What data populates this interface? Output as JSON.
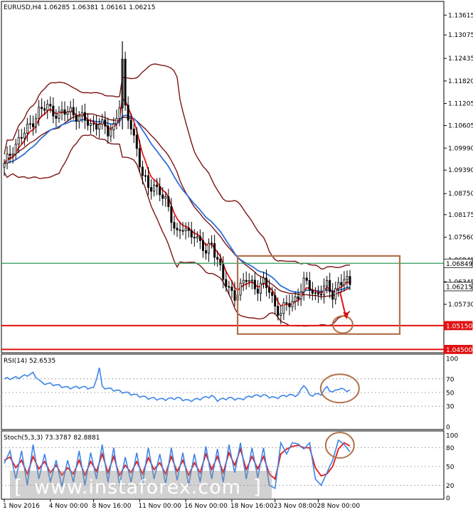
{
  "chart_data": {
    "type": "candlestick",
    "symbol_header": "EURUSD,H4 1.06285 1.06381 1.06161 1.06215",
    "main": {
      "ylim": [
        1.0445,
        1.1395
      ],
      "y_ticks": [
        "1.13615",
        "1.13075",
        "1.12435",
        "1.11820",
        "1.11205",
        "1.10605",
        "1.09990",
        "1.09390",
        "1.08750",
        "1.08175",
        "1.07560",
        "1.06945",
        "1.06345",
        "1.05730",
        "1.05150",
        "1.04500"
      ],
      "price_tags": [
        {
          "label": "1.06849",
          "value": 1.06849,
          "bg": "#ffffff",
          "fg": "#000000",
          "line": "#2e9a58"
        },
        {
          "label": "1.06215",
          "value": 1.06215,
          "bg": "#ffffff",
          "fg": "#000000",
          "line": null
        },
        {
          "label": "1.05150",
          "value": 1.0515,
          "bg": "#e01010",
          "fg": "#ffffff",
          "line": "#e01010"
        },
        {
          "label": "1.04500",
          "value": 1.045,
          "bg": "#e01010",
          "fg": "#ffffff",
          "line": "#e01010"
        }
      ],
      "anchors": [
        [
          0,
          1.095
        ],
        [
          3,
          1.1
        ],
        [
          8,
          1.105
        ],
        [
          12,
          1.11
        ],
        [
          15,
          1.111
        ],
        [
          19,
          1.109
        ],
        [
          23,
          1.11
        ],
        [
          27,
          1.108
        ],
        [
          30,
          1.106
        ],
        [
          33,
          1.107
        ],
        [
          36,
          1.104
        ],
        [
          38,
          1.106
        ],
        [
          40,
          1.112
        ],
        [
          41,
          1.123
        ],
        [
          42,
          1.11
        ],
        [
          44,
          1.106
        ],
        [
          46,
          1.1
        ],
        [
          48,
          1.092
        ],
        [
          50,
          1.089
        ],
        [
          52,
          1.09
        ],
        [
          54,
          1.088
        ],
        [
          56,
          1.085
        ],
        [
          58,
          1.081
        ],
        [
          60,
          1.077
        ],
        [
          62,
          1.078
        ],
        [
          64,
          1.076
        ],
        [
          66,
          1.077
        ],
        [
          68,
          1.074
        ],
        [
          70,
          1.071
        ],
        [
          72,
          1.074
        ],
        [
          74,
          1.07
        ],
        [
          76,
          1.064
        ],
        [
          78,
          1.061
        ],
        [
          80,
          1.06
        ],
        [
          82,
          1.062
        ],
        [
          84,
          1.064
        ],
        [
          86,
          1.063
        ],
        [
          88,
          1.062
        ],
        [
          90,
          1.063
        ],
        [
          92,
          1.061
        ],
        [
          94,
          1.057
        ],
        [
          96,
          1.055
        ],
        [
          98,
          1.057
        ],
        [
          100,
          1.058
        ],
        [
          102,
          1.06
        ],
        [
          104,
          1.063
        ],
        [
          106,
          1.062
        ],
        [
          108,
          1.06
        ],
        [
          110,
          1.061
        ],
        [
          112,
          1.062
        ],
        [
          114,
          1.06
        ],
        [
          116,
          1.063
        ],
        [
          118,
          1.064
        ],
        [
          120,
          1.0622
        ]
      ],
      "series_colors": {
        "candles": "#000000",
        "bollinger": "#7b1414",
        "ma_fast": "#e81818",
        "ma_slow": "#2f6fd8"
      },
      "range_box": {
        "x_from": 81,
        "x_to": 120,
        "y_top": 1.0705,
        "y_bottom": 1.0492,
        "color": "#b0714a"
      },
      "target_circle": {
        "x": 117.5,
        "y": 1.0518,
        "color": "#b0714a"
      },
      "arrow": {
        "from": [
          116.5,
          1.0608
        ],
        "to": [
          118.6,
          1.0538
        ],
        "color": "#e01010"
      }
    },
    "rsi": {
      "label": "RSI(14) 52.6535",
      "ylim": [
        0,
        100
      ],
      "y_ticks": [
        "100",
        "70",
        "50",
        "30",
        "0"
      ],
      "anchors": [
        [
          0,
          70
        ],
        [
          5,
          72
        ],
        [
          10,
          78
        ],
        [
          13,
          64
        ],
        [
          17,
          62
        ],
        [
          22,
          57
        ],
        [
          27,
          58
        ],
        [
          31,
          56
        ],
        [
          33,
          86
        ],
        [
          34,
          58
        ],
        [
          38,
          54
        ],
        [
          42,
          50
        ],
        [
          46,
          46
        ],
        [
          50,
          42
        ],
        [
          55,
          40
        ],
        [
          60,
          42
        ],
        [
          64,
          38
        ],
        [
          68,
          41
        ],
        [
          72,
          45
        ],
        [
          74,
          39
        ],
        [
          78,
          42
        ],
        [
          82,
          40
        ],
        [
          86,
          45
        ],
        [
          90,
          46
        ],
        [
          94,
          42
        ],
        [
          98,
          46
        ],
        [
          102,
          46
        ],
        [
          104,
          62
        ],
        [
          106,
          46
        ],
        [
          110,
          48
        ],
        [
          112,
          58
        ],
        [
          114,
          50
        ],
        [
          116,
          56
        ],
        [
          118,
          54
        ],
        [
          120,
          52.65
        ]
      ],
      "line_color": "#3d85e8",
      "circle": {
        "x": 116.5,
        "y": 56,
        "color": "#b0714a"
      }
    },
    "stoch": {
      "label": "Stoch(5,3,3) 73.3787 82.8881",
      "ylim": [
        0,
        100
      ],
      "y_ticks": [
        "100",
        "80",
        "50",
        "20",
        "0"
      ],
      "k_anchors": [
        [
          0,
          55
        ],
        [
          2,
          75
        ],
        [
          4,
          30
        ],
        [
          6,
          75
        ],
        [
          8,
          20
        ],
        [
          10,
          85
        ],
        [
          12,
          30
        ],
        [
          14,
          70
        ],
        [
          16,
          25
        ],
        [
          18,
          60
        ],
        [
          20,
          18
        ],
        [
          22,
          60
        ],
        [
          24,
          25
        ],
        [
          26,
          75
        ],
        [
          28,
          20
        ],
        [
          30,
          72
        ],
        [
          32,
          30
        ],
        [
          34,
          85
        ],
        [
          36,
          25
        ],
        [
          38,
          80
        ],
        [
          40,
          20
        ],
        [
          42,
          65
        ],
        [
          44,
          25
        ],
        [
          46,
          72
        ],
        [
          48,
          22
        ],
        [
          50,
          80
        ],
        [
          52,
          30
        ],
        [
          54,
          70
        ],
        [
          56,
          22
        ],
        [
          58,
          80
        ],
        [
          60,
          28
        ],
        [
          62,
          72
        ],
        [
          64,
          20
        ],
        [
          66,
          70
        ],
        [
          68,
          25
        ],
        [
          70,
          82
        ],
        [
          72,
          30
        ],
        [
          74,
          78
        ],
        [
          76,
          25
        ],
        [
          78,
          85
        ],
        [
          80,
          40
        ],
        [
          82,
          88
        ],
        [
          84,
          30
        ],
        [
          86,
          80
        ],
        [
          88,
          32
        ],
        [
          90,
          80
        ],
        [
          92,
          20
        ],
        [
          94,
          15
        ],
        [
          96,
          88
        ],
        [
          98,
          70
        ],
        [
          100,
          88
        ],
        [
          102,
          86
        ],
        [
          104,
          78
        ],
        [
          106,
          88
        ],
        [
          108,
          30
        ],
        [
          110,
          20
        ],
        [
          112,
          40
        ],
        [
          114,
          60
        ],
        [
          116,
          92
        ],
        [
          118,
          85
        ],
        [
          120,
          73.38
        ]
      ],
      "d_anchors": [
        [
          0,
          60
        ],
        [
          2,
          65
        ],
        [
          4,
          48
        ],
        [
          6,
          60
        ],
        [
          8,
          38
        ],
        [
          10,
          66
        ],
        [
          12,
          46
        ],
        [
          14,
          58
        ],
        [
          16,
          40
        ],
        [
          18,
          52
        ],
        [
          20,
          36
        ],
        [
          22,
          48
        ],
        [
          24,
          38
        ],
        [
          26,
          60
        ],
        [
          28,
          36
        ],
        [
          30,
          58
        ],
        [
          32,
          42
        ],
        [
          34,
          70
        ],
        [
          36,
          40
        ],
        [
          38,
          66
        ],
        [
          40,
          36
        ],
        [
          42,
          52
        ],
        [
          44,
          40
        ],
        [
          46,
          58
        ],
        [
          48,
          38
        ],
        [
          50,
          64
        ],
        [
          52,
          45
        ],
        [
          54,
          56
        ],
        [
          56,
          38
        ],
        [
          58,
          66
        ],
        [
          60,
          42
        ],
        [
          62,
          60
        ],
        [
          64,
          36
        ],
        [
          66,
          56
        ],
        [
          68,
          40
        ],
        [
          70,
          70
        ],
        [
          72,
          45
        ],
        [
          74,
          66
        ],
        [
          76,
          40
        ],
        [
          78,
          72
        ],
        [
          80,
          52
        ],
        [
          82,
          78
        ],
        [
          84,
          45
        ],
        [
          86,
          66
        ],
        [
          88,
          46
        ],
        [
          90,
          66
        ],
        [
          92,
          38
        ],
        [
          94,
          30
        ],
        [
          96,
          70
        ],
        [
          98,
          78
        ],
        [
          100,
          82
        ],
        [
          102,
          84
        ],
        [
          104,
          80
        ],
        [
          106,
          80
        ],
        [
          108,
          48
        ],
        [
          110,
          35
        ],
        [
          112,
          38
        ],
        [
          114,
          50
        ],
        [
          116,
          78
        ],
        [
          118,
          88
        ],
        [
          120,
          82.89
        ]
      ],
      "k_color": "#3d85e8",
      "d_color": "#e81818",
      "circle": {
        "x": 116.5,
        "y": 84,
        "color": "#b0714a"
      }
    },
    "x_tick_labels": [
      "1 Nov 2016",
      "4 Nov 00:00",
      "8 Nov 16:00",
      "11 Nov 00:00",
      "16 Nov 00:00",
      "18 Nov 16:00",
      "23 Nov 08:00",
      "28 Nov 00:00"
    ],
    "x_tick_positions": [
      0,
      16,
      31,
      47,
      63,
      79,
      94,
      109
    ],
    "n_bars": 121
  },
  "watermark": {
    "text": "www.instaforex.com"
  }
}
